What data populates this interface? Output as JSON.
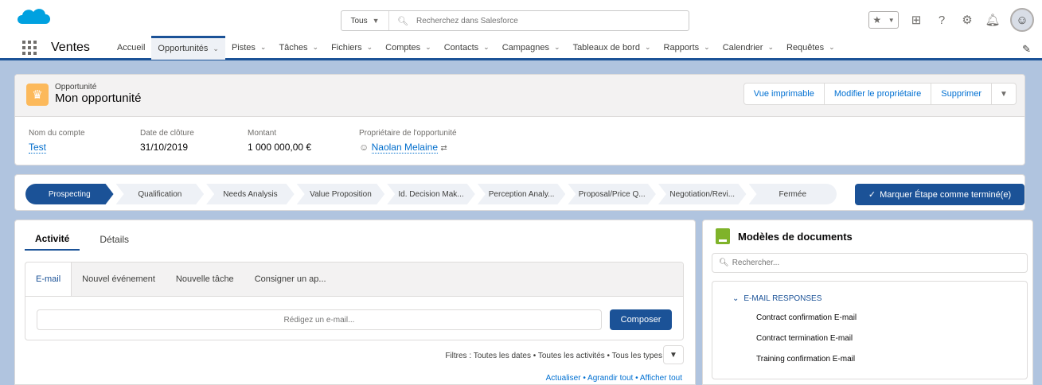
{
  "search": {
    "scope": "Tous",
    "placeholder": "Recherchez dans Salesforce"
  },
  "nav": {
    "app_name": "Ventes",
    "items": [
      {
        "label": "Accueil",
        "has_menu": false
      },
      {
        "label": "Opportunités",
        "has_menu": true
      },
      {
        "label": "Pistes",
        "has_menu": true
      },
      {
        "label": "Tâches",
        "has_menu": true
      },
      {
        "label": "Fichiers",
        "has_menu": true
      },
      {
        "label": "Comptes",
        "has_menu": true
      },
      {
        "label": "Contacts",
        "has_menu": true
      },
      {
        "label": "Campagnes",
        "has_menu": true
      },
      {
        "label": "Tableaux de bord",
        "has_menu": true
      },
      {
        "label": "Rapports",
        "has_menu": true
      },
      {
        "label": "Calendrier",
        "has_menu": true
      },
      {
        "label": "Requêtes",
        "has_menu": true
      }
    ],
    "active_index": 1
  },
  "record": {
    "type": "Opportunité",
    "title": "Mon opportunité",
    "actions": [
      "Vue imprimable",
      "Modifier le propriétaire",
      "Supprimer"
    ],
    "fields": [
      {
        "label": "Nom du compte",
        "value": "Test",
        "link": true
      },
      {
        "label": "Date de clôture",
        "value": "31/10/2019",
        "link": false
      },
      {
        "label": "Montant",
        "value": "1 000 000,00 €",
        "link": false
      },
      {
        "label": "Propriétaire de l'opportunité",
        "value": "Naolan Melaine",
        "link": true
      }
    ]
  },
  "path": {
    "stages": [
      "Prospecting",
      "Qualification",
      "Needs Analysis",
      "Value Proposition",
      "Id. Decision Mak...",
      "Perception Analy...",
      "Proposal/Price Q...",
      "Negotiation/Revi...",
      "Fermée"
    ],
    "current_index": 0,
    "mark_button": "Marquer Étape comme terminé(e)"
  },
  "activity": {
    "tabs": [
      "Activité",
      "Détails"
    ],
    "sub_tabs": [
      "E-mail",
      "Nouvel événement",
      "Nouvelle tâche",
      "Consigner un ap..."
    ],
    "email_placeholder": "Rédigez un e-mail...",
    "compose_label": "Composer",
    "filters": "Filtres : Toutes les dates • Toutes les activités • Tous les types",
    "footer_links": "Actualiser • Agrandir tout • Afficher tout"
  },
  "templates": {
    "title": "Modèles de documents",
    "search_placeholder": "Rechercher...",
    "folder": "E-MAIL RESPONSES",
    "items": [
      "Contract confirmation E-mail",
      "Contract termination E-mail",
      "Training confirmation E-mail"
    ]
  },
  "colors": {
    "brand": "#1b5297",
    "link": "#0070d2",
    "background": "#b0c4df"
  }
}
